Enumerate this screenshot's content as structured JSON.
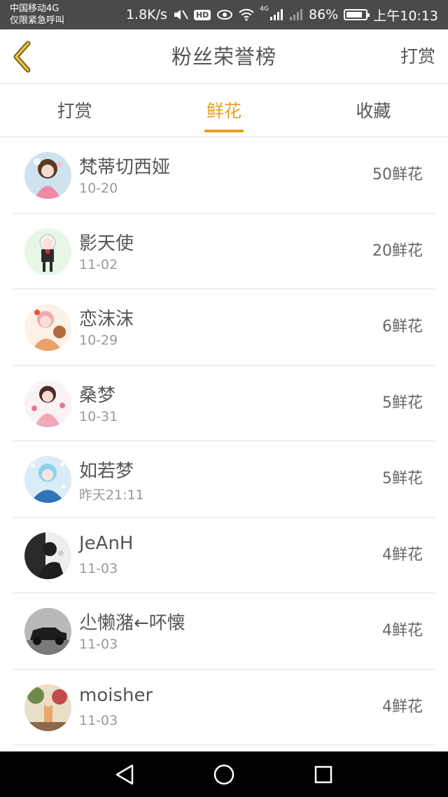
{
  "status_bar": {
    "carrier_line1": "中国移动4G",
    "carrier_line2": "仅限紧急呼叫",
    "speed": "1.8K/s",
    "hd": "HD",
    "network": "4G",
    "battery_percent": "86%",
    "battery_level": 0.86,
    "time": "上午10:13",
    "icons": [
      "mute-icon",
      "eye-icon",
      "wifi-icon",
      "signal-icon",
      "battery-icon"
    ]
  },
  "header": {
    "title": "粉丝荣誉榜",
    "action_label": "打赏",
    "back_icon": "chevron-left-icon"
  },
  "tabs": [
    {
      "label": "打赏",
      "active": false
    },
    {
      "label": "鲜花",
      "active": true
    },
    {
      "label": "收藏",
      "active": false
    }
  ],
  "colors": {
    "accent": "#e8a020",
    "status_bar": "#4a4a4a",
    "divider": "#e3e3e3"
  },
  "fans": [
    {
      "name": "梵蒂切西娅",
      "time": "10-20",
      "amount": "50鲜花"
    },
    {
      "name": "影天使",
      "time": "11-02",
      "amount": "20鲜花"
    },
    {
      "name": "恋沫沫",
      "time": "10-29",
      "amount": "6鲜花"
    },
    {
      "name": "桑梦",
      "time": "10-31",
      "amount": "5鲜花"
    },
    {
      "name": "如若梦",
      "time": "昨天21:11",
      "amount": "5鲜花"
    },
    {
      "name": "JeAnH",
      "time": "11-03",
      "amount": "4鲜花"
    },
    {
      "name": "尐懒潴←吥懐",
      "time": "11-03",
      "amount": "4鲜花"
    },
    {
      "name": "moisher",
      "time": "11-03",
      "amount": "4鲜花"
    }
  ],
  "nav_bar": {
    "icons": [
      "back-triangle-icon",
      "home-circle-icon",
      "recents-square-icon"
    ]
  }
}
